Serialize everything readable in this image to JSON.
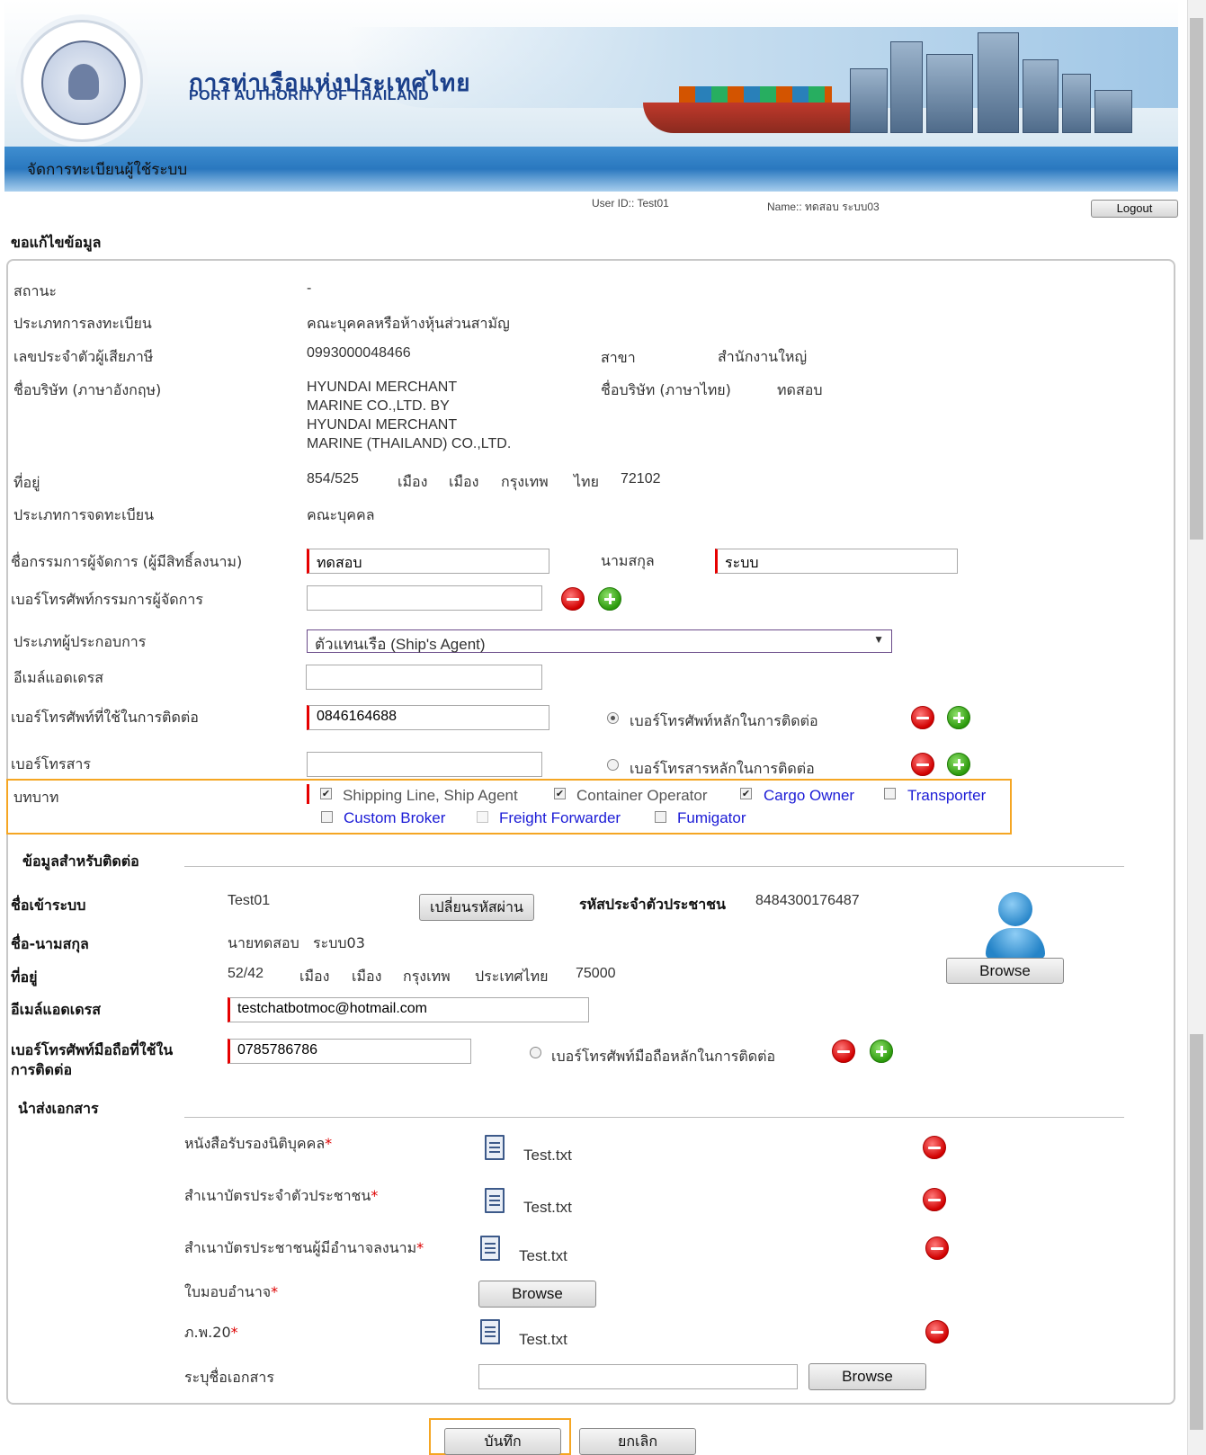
{
  "header": {
    "brand_th": "การท่าเรือแห่งประเทศไทย",
    "brand_en": "PORT AUTHORITY OF THAILAND",
    "page_title": "จัดการทะเบียนผู้ใช้ระบบ",
    "user_id": "User ID:: Test01",
    "user_name": "Name:: ทดสอบ ระบบ03",
    "logout": "Logout"
  },
  "section_title": "ขอแก้ไขข้อมูล",
  "company": {
    "status_label": "สถานะ",
    "status_value": "-",
    "reg_type_label": "ประเภทการลงทะเบียน",
    "reg_type_value": "คณะบุคคลหรือห้างหุ้นส่วนสามัญ",
    "tax_id_label": "เลขประจำตัวผู้เสียภาษี",
    "tax_id_value": "0993000048466",
    "branch_label": "สาขา",
    "branch_value": "สำนักงานใหญ่",
    "name_en_label": "ชื่อบริษัท (ภาษาอังกฤษ)",
    "name_en_lines": [
      "HYUNDAI MERCHANT",
      "MARINE CO.,LTD. BY",
      "HYUNDAI MERCHANT",
      "MARINE (THAILAND) CO.,LTD."
    ],
    "name_th_label": "ชื่อบริษัท (ภาษาไทย)",
    "name_th_value": "ทดสอบ",
    "address_label": "ที่อยู่",
    "address_parts": [
      "854/525",
      "เมือง",
      "เมือง",
      "กรุงเทพ",
      "ไทย",
      "72102"
    ],
    "record_type_label": "ประเภทการจดทะเบียน",
    "record_type_value": "คณะบุคคล",
    "director_label": "ชื่อกรรมการผู้จัดการ (ผู้มีสิทธิ์ลงนาม)",
    "director_first": "ทดสอบ",
    "surname_label": "นามสกุล",
    "director_last": "ระบบ",
    "director_phone_label": "เบอร์โทรศัพท์กรรมการผู้จัดการ",
    "director_phone_value": "",
    "operator_type_label": "ประเภทผู้ประกอบการ",
    "operator_type_value": "ตัวแทนเรือ (Ship's Agent)",
    "email_label": "อีเมล์แอดเดรส",
    "email_value": "",
    "contact_phone_label": "เบอร์โทรศัพท์ที่ใช้ในการติดต่อ",
    "contact_phone_value": "0846164688",
    "primary_phone_label": "เบอร์โทรศัพท์หลักในการติดต่อ",
    "fax_label": "เบอร์โทรสาร",
    "fax_value": "",
    "primary_fax_label": "เบอร์โทรสารหลักในการติดต่อ",
    "roles_label": "บทบาท",
    "roles": [
      {
        "label": "Shipping Line, Ship Agent",
        "checked": true
      },
      {
        "label": "Container Operator",
        "checked": true
      },
      {
        "label": "Cargo Owner",
        "checked": true
      },
      {
        "label": "Transporter",
        "checked": false
      },
      {
        "label": "Custom Broker",
        "checked": false
      },
      {
        "label": "Freight Forwarder",
        "checked": false
      },
      {
        "label": "Fumigator",
        "checked": false
      }
    ]
  },
  "contact": {
    "title": "ข้อมูลสำหรับติดต่อ",
    "login_label": "ชื่อเข้าระบบ",
    "login_value": "Test01",
    "change_pw": "เปลี่ยนรหัสผ่าน",
    "citizen_label": "รหัสประจำตัวประชาชน",
    "citizen_value": "8484300176487",
    "fullname_label": "ชื่อ-นามสกุล",
    "fullname_value": "นายทดสอบ   ระบบ03",
    "address_label": "ที่อยู่",
    "address_parts": [
      "52/42",
      "เมือง",
      "เมือง",
      "กรุงเทพ",
      "ประเทศไทย",
      "75000"
    ],
    "browse": "Browse",
    "email_label": "อีเมล์แอดเดรส",
    "email_value": "testchatbotmoc@hotmail.com",
    "mobile_label_1": "เบอร์โทรศัพท์มือถือที่ใช้ใน",
    "mobile_label_2": "การติดต่อ",
    "mobile_value": "0785786786",
    "primary_mobile_label": "เบอร์โทรศัพท์มือถือหลักในการติดต่อ"
  },
  "docs": {
    "title": "นำส่งเอกสาร",
    "items": [
      {
        "label": "หนังสือรับรองนิติบุคคล",
        "file": "Test.txt"
      },
      {
        "label": "สำเนาบัตรประจำตัวประชาชน",
        "file": "Test.txt"
      },
      {
        "label": "สำเนาบัตรประชาชนผู้มีอำนาจลงนาม",
        "file": "Test.txt"
      },
      {
        "label": "ใบมอบอำนาจ",
        "file": ""
      },
      {
        "label": "ภ.พ.20",
        "file": "Test.txt"
      }
    ],
    "star": "*",
    "browse": "Browse",
    "other_label": "ระบุชื่อเอกสาร",
    "other_value": ""
  },
  "actions": {
    "save": "บันทึก",
    "cancel": "ยกเลิก"
  }
}
